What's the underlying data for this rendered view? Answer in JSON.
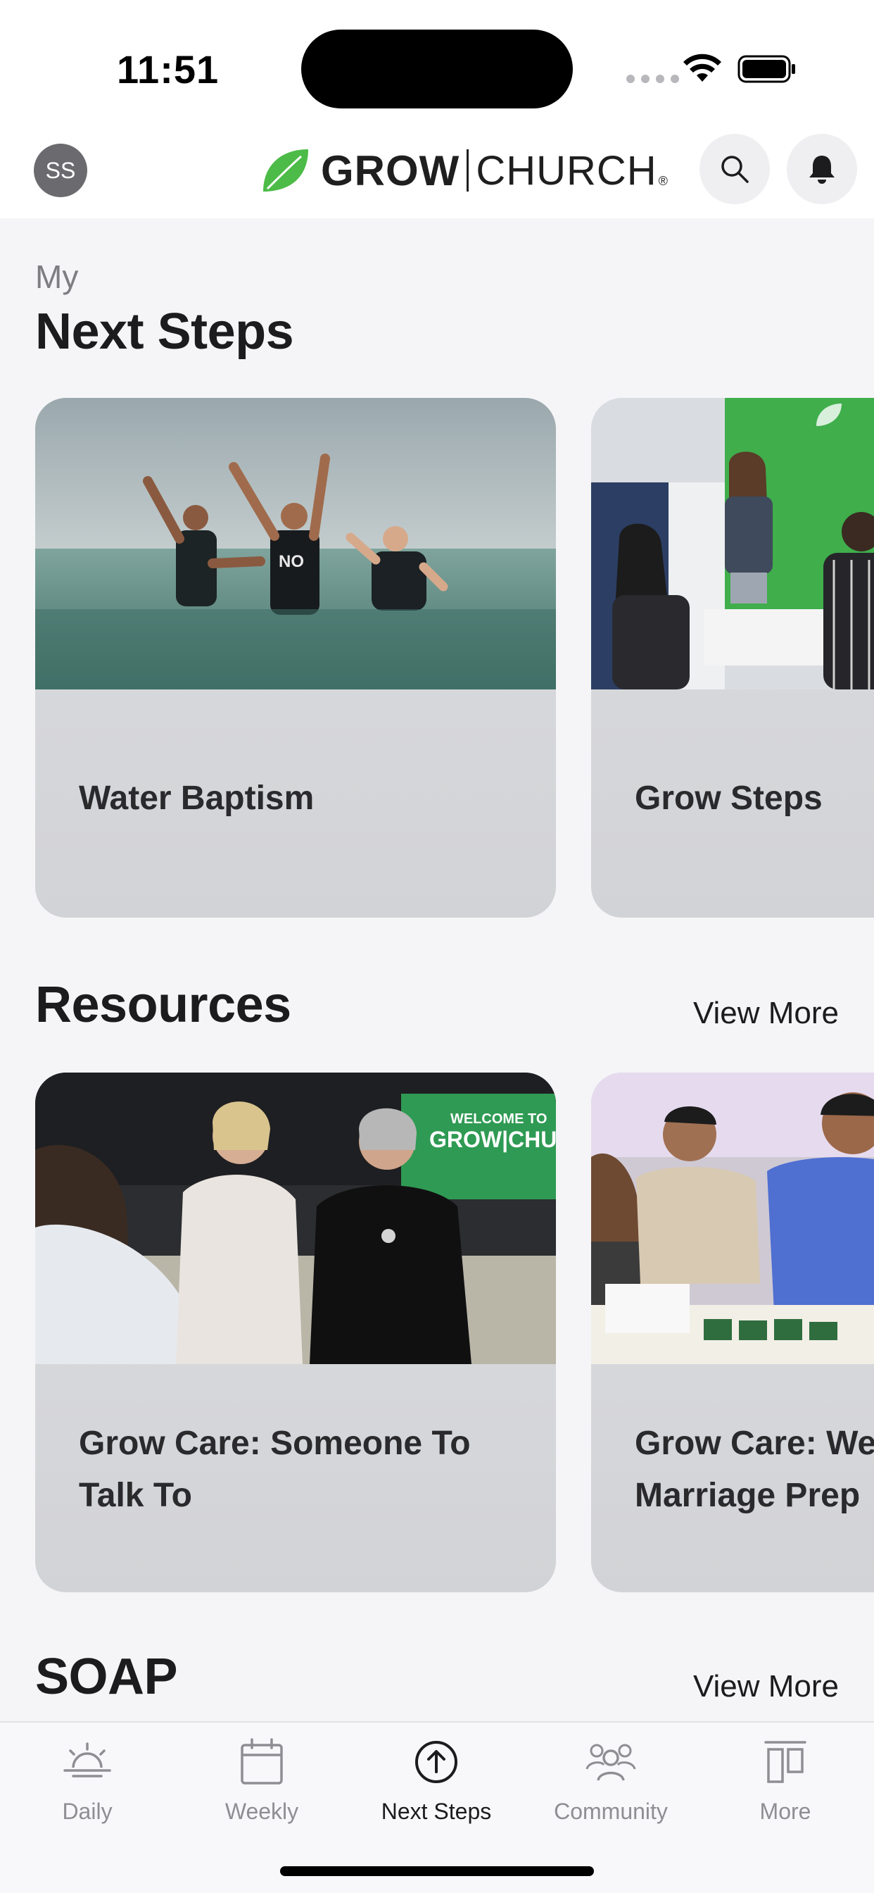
{
  "status_bar": {
    "time": "11:51"
  },
  "header": {
    "avatar_initials": "SS",
    "logo_primary": "GROW",
    "logo_secondary": "CHURCH",
    "logo_mark": "®",
    "search_icon": "search-icon",
    "notifications_icon": "bell-icon"
  },
  "next_steps": {
    "eyebrow": "My",
    "title": "Next Steps",
    "cards": [
      {
        "title": "Water Baptism"
      },
      {
        "title": "Grow Steps"
      }
    ]
  },
  "resources": {
    "title": "Resources",
    "view_more": "View More",
    "cards": [
      {
        "title": "Grow Care: Someone To Talk To"
      },
      {
        "title": "Grow Care: Wedding & Marriage Prep"
      }
    ]
  },
  "soap": {
    "title": "SOAP",
    "view_more": "View More"
  },
  "tab_bar": {
    "tabs": [
      {
        "label": "Daily",
        "icon": "sunrise-icon",
        "active": false
      },
      {
        "label": "Weekly",
        "icon": "calendar-icon",
        "active": false
      },
      {
        "label": "Next Steps",
        "icon": "arrow-up-circle-icon",
        "active": true
      },
      {
        "label": "Community",
        "icon": "people-icon",
        "active": false
      },
      {
        "label": "More",
        "icon": "columns-icon",
        "active": false
      }
    ]
  },
  "colors": {
    "accent_green": "#4cbb47",
    "background": "#f5f5f7",
    "card": "#d8d9dc",
    "text": "#1c1c1e",
    "inactive_tab": "#8e8e93"
  }
}
